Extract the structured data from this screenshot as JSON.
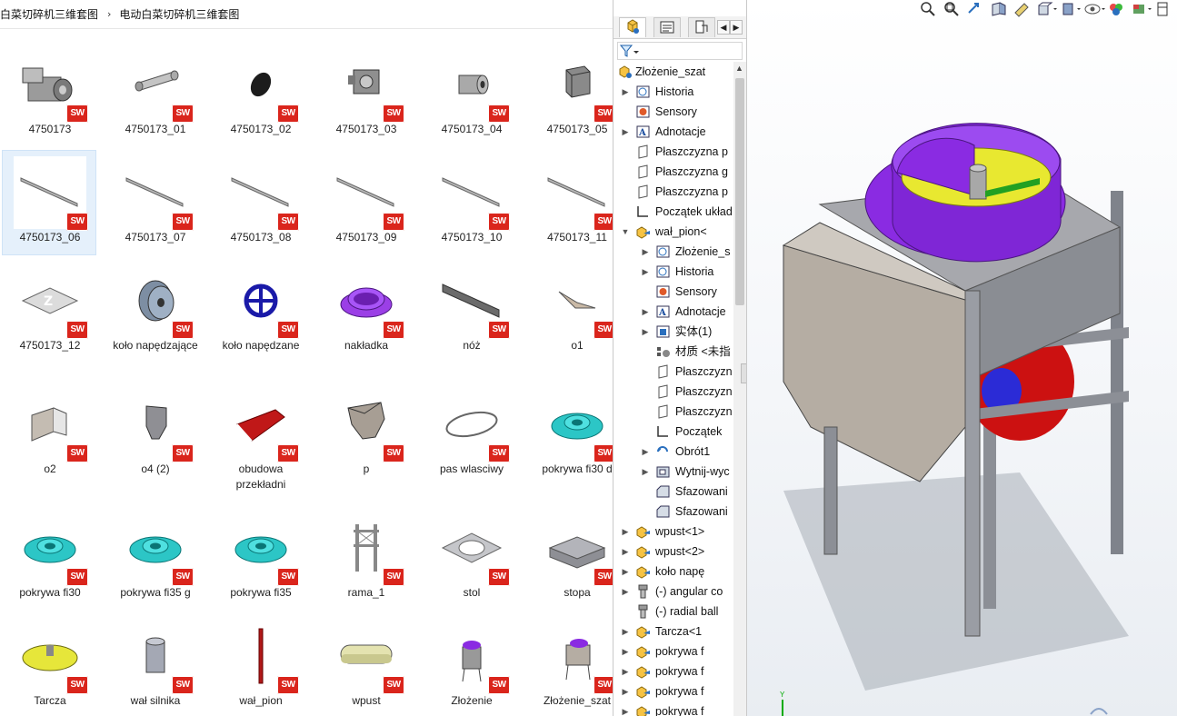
{
  "breadcrumb": {
    "items": [
      "白菜切碎机三维套图",
      "电动白菜切碎机三维套图"
    ],
    "separator": "›"
  },
  "files": [
    {
      "label": "4750173",
      "thumb": "motor",
      "selected": false
    },
    {
      "label": "4750173_01",
      "thumb": "shaft",
      "selected": false
    },
    {
      "label": "4750173_02",
      "thumb": "disc-dark",
      "selected": false
    },
    {
      "label": "4750173_03",
      "thumb": "gearbox",
      "selected": false
    },
    {
      "label": "4750173_04",
      "thumb": "cylinder",
      "selected": false
    },
    {
      "label": "4750173_05",
      "thumb": "box",
      "selected": false
    },
    {
      "label": "4750173_06",
      "thumb": "rod",
      "selected": true
    },
    {
      "label": "4750173_07",
      "thumb": "rod",
      "selected": false
    },
    {
      "label": "4750173_08",
      "thumb": "rod",
      "selected": false
    },
    {
      "label": "4750173_09",
      "thumb": "rod",
      "selected": false
    },
    {
      "label": "4750173_10",
      "thumb": "rod",
      "selected": false
    },
    {
      "label": "4750173_11",
      "thumb": "rod",
      "selected": false
    },
    {
      "label": "4750173_12",
      "thumb": "plate-z",
      "selected": false
    },
    {
      "label": "koło napędzające",
      "thumb": "pulley",
      "selected": false
    },
    {
      "label": "koło napędzane",
      "thumb": "wheel-blue",
      "selected": false
    },
    {
      "label": "nakładka",
      "thumb": "ring-purple",
      "selected": false
    },
    {
      "label": "nóż",
      "thumb": "blade",
      "selected": false
    },
    {
      "label": "o1",
      "thumb": "small-blade",
      "selected": false
    },
    {
      "label": "o2",
      "thumb": "bracket",
      "selected": false
    },
    {
      "label": "o4 (2)",
      "thumb": "hopper-small",
      "selected": false
    },
    {
      "label": "obudowa przekładni",
      "thumb": "red-cover",
      "selected": false
    },
    {
      "label": "p",
      "thumb": "hopper",
      "selected": false
    },
    {
      "label": "pas wlasciwy",
      "thumb": "belt",
      "selected": false
    },
    {
      "label": "pokrywa fi30 d",
      "thumb": "flange",
      "selected": false
    },
    {
      "label": "pokrywa fi30",
      "thumb": "flange",
      "selected": false
    },
    {
      "label": "pokrywa fi35 g",
      "thumb": "flange",
      "selected": false
    },
    {
      "label": "pokrywa fi35",
      "thumb": "flange",
      "selected": false
    },
    {
      "label": "rama_1",
      "thumb": "frame",
      "selected": false
    },
    {
      "label": "stol",
      "thumb": "table-plate",
      "selected": false
    },
    {
      "label": "stopa",
      "thumb": "block",
      "selected": false
    },
    {
      "label": "Tarcza",
      "thumb": "disc-yellow",
      "selected": false
    },
    {
      "label": "wał silnika",
      "thumb": "motor-shaft",
      "selected": false
    },
    {
      "label": "wał_pion",
      "thumb": "vertical-shaft",
      "selected": false
    },
    {
      "label": "wpust",
      "thumb": "key",
      "selected": false
    },
    {
      "label": "Złożenie",
      "thumb": "assembly",
      "selected": false
    },
    {
      "label": "Złożenie_szat",
      "thumb": "assembly-cover",
      "selected": false
    }
  ],
  "featuremanager": {
    "tabs": [
      "feature-manager-tab",
      "property-manager-tab",
      "configuration-manager-tab"
    ],
    "filter_icon": "funnel-icon",
    "tree": [
      {
        "label": "Złożenie_szat",
        "expander": "",
        "indent": 0,
        "icon": "assembly-icon"
      },
      {
        "label": "Historia",
        "expander": "▶",
        "indent": 1,
        "icon": "history-icon"
      },
      {
        "label": "Sensory",
        "expander": "",
        "indent": 1,
        "icon": "sensor-icon"
      },
      {
        "label": "Adnotacje",
        "expander": "▶",
        "indent": 1,
        "icon": "annotation-icon"
      },
      {
        "label": "Płaszczyzna p",
        "expander": "",
        "indent": 1,
        "icon": "plane-icon"
      },
      {
        "label": "Płaszczyzna g",
        "expander": "",
        "indent": 1,
        "icon": "plane-icon"
      },
      {
        "label": "Płaszczyzna p",
        "expander": "",
        "indent": 1,
        "icon": "plane-icon"
      },
      {
        "label": "Początek układ",
        "expander": "",
        "indent": 1,
        "icon": "origin-icon"
      },
      {
        "label": "wał_pion<",
        "expander": "▼",
        "indent": 1,
        "icon": "part-icon"
      },
      {
        "label": "Złożenie_s",
        "expander": "▶",
        "indent": 2,
        "icon": "history-icon"
      },
      {
        "label": "Historia",
        "expander": "▶",
        "indent": 2,
        "icon": "history-icon"
      },
      {
        "label": "Sensory",
        "expander": "",
        "indent": 2,
        "icon": "sensor-icon"
      },
      {
        "label": "Adnotacje",
        "expander": "▶",
        "indent": 2,
        "icon": "annotation-icon"
      },
      {
        "label": "实体(1)",
        "expander": "▶",
        "indent": 2,
        "icon": "solid-body-icon"
      },
      {
        "label": "材质 <未指",
        "expander": "",
        "indent": 2,
        "icon": "material-icon"
      },
      {
        "label": "Płaszczyzn",
        "expander": "",
        "indent": 2,
        "icon": "plane-icon"
      },
      {
        "label": "Płaszczyzn",
        "expander": "",
        "indent": 2,
        "icon": "plane-icon"
      },
      {
        "label": "Płaszczyzn",
        "expander": "",
        "indent": 2,
        "icon": "plane-icon"
      },
      {
        "label": "Początek",
        "expander": "",
        "indent": 2,
        "icon": "origin-icon"
      },
      {
        "label": "Obrót1",
        "expander": "▶",
        "indent": 2,
        "icon": "revolve-icon"
      },
      {
        "label": "Wytnij-wyc",
        "expander": "▶",
        "indent": 2,
        "icon": "cut-icon"
      },
      {
        "label": "Sfazowani",
        "expander": "",
        "indent": 2,
        "icon": "chamfer-icon"
      },
      {
        "label": "Sfazowani",
        "expander": "",
        "indent": 2,
        "icon": "chamfer-icon"
      },
      {
        "label": "wpust<1>",
        "expander": "▶",
        "indent": 1,
        "icon": "part-icon"
      },
      {
        "label": "wpust<2>",
        "expander": "▶",
        "indent": 1,
        "icon": "part-icon"
      },
      {
        "label": "koło napę",
        "expander": "▶",
        "indent": 1,
        "icon": "part-icon"
      },
      {
        "label": "(-) angular co",
        "expander": "▶",
        "indent": 1,
        "icon": "bolt-icon"
      },
      {
        "label": "(-) radial ball",
        "expander": "",
        "indent": 1,
        "icon": "bolt-icon"
      },
      {
        "label": "Tarcza<1",
        "expander": "▶",
        "indent": 1,
        "icon": "part-icon"
      },
      {
        "label": "pokrywa f",
        "expander": "▶",
        "indent": 1,
        "icon": "part-icon"
      },
      {
        "label": "pokrywa f",
        "expander": "▶",
        "indent": 1,
        "icon": "part-icon"
      },
      {
        "label": "pokrywa f",
        "expander": "▶",
        "indent": 1,
        "icon": "part-icon"
      },
      {
        "label": "pokrywa f",
        "expander": "▶",
        "indent": 1,
        "icon": "part-icon"
      }
    ]
  },
  "viewport": {
    "hud_icons": [
      "zoom-to-fit-icon",
      "zoom-area-icon",
      "previous-view-icon",
      "section-view-icon",
      "dynamic-annotation-icon",
      "view-orientation-icon",
      "display-style-icon",
      "hide-show-icon",
      "edit-appearance-icon",
      "apply-scene-icon",
      "view-settings-icon"
    ],
    "triad_axis": "Y",
    "colors": {
      "purple": "#8a2be2",
      "frame": "#8c8f96",
      "panel": "#b5ada3",
      "red": "#cc1111",
      "yellow": "#e8e830",
      "green": "#22a022"
    }
  }
}
